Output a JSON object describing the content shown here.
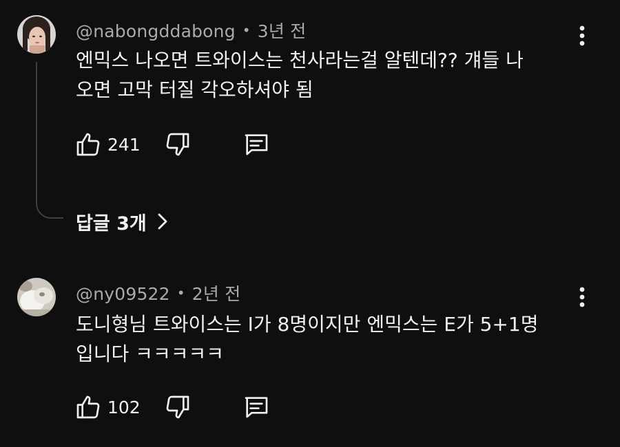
{
  "comments": [
    {
      "author": "@nabongddabong",
      "time": "3년 전",
      "text_line1": "엔믹스 나오면 트와이스는 천사라는걸 알텐데?? 걔들 나",
      "text_line2": "오면 고막 터질 각오하셔야 됨",
      "likes": "241",
      "replies_label": "답글 3개"
    },
    {
      "author": "@ny09522",
      "time": "2년 전",
      "text_line1": "도니형님 트와이스는 I가 8명이지만 엔믹스는 E가 5+1명",
      "text_line2": "입니다 ㅋㅋㅋㅋㅋ",
      "likes": "102"
    }
  ],
  "meta_separator": "•",
  "icons": {
    "like": "thumbs-up-icon",
    "dislike": "thumbs-down-icon",
    "reply": "comment-reply-icon",
    "more": "more-vert-icon",
    "chevron": "chevron-right-icon"
  },
  "colors": {
    "background": "#0f0f0f",
    "primary_text": "#f1f1f1",
    "secondary_text": "#aaaaaa",
    "thread_line": "#3f3f3f"
  }
}
